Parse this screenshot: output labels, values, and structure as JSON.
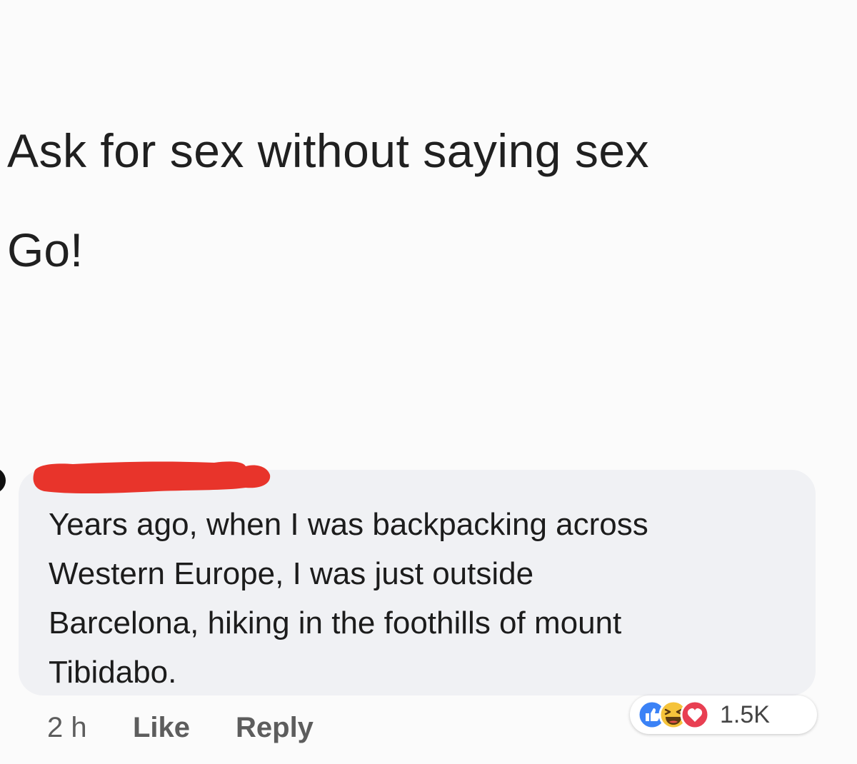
{
  "post": {
    "title": "Ask for sex without saying sex",
    "subtitle": "Go!"
  },
  "comment": {
    "lines": [
      "Years ago, when I was backpacking across",
      "Western Europe, I was just outside",
      "Barcelona, hiking in the foothills of mount",
      "Tibidabo."
    ],
    "redaction_color": "#e8342b",
    "bubble_color": "#f0f1f4",
    "timestamp": "2 h",
    "like_label": "Like",
    "reply_label": "Reply",
    "reactions": {
      "icons": [
        "like-reaction-icon",
        "haha-reaction-icon",
        "love-reaction-icon"
      ],
      "count": "1.5K",
      "colors": {
        "like": "#3b82f6",
        "haha": "#f5c33b",
        "love": "#e83f52"
      }
    }
  }
}
